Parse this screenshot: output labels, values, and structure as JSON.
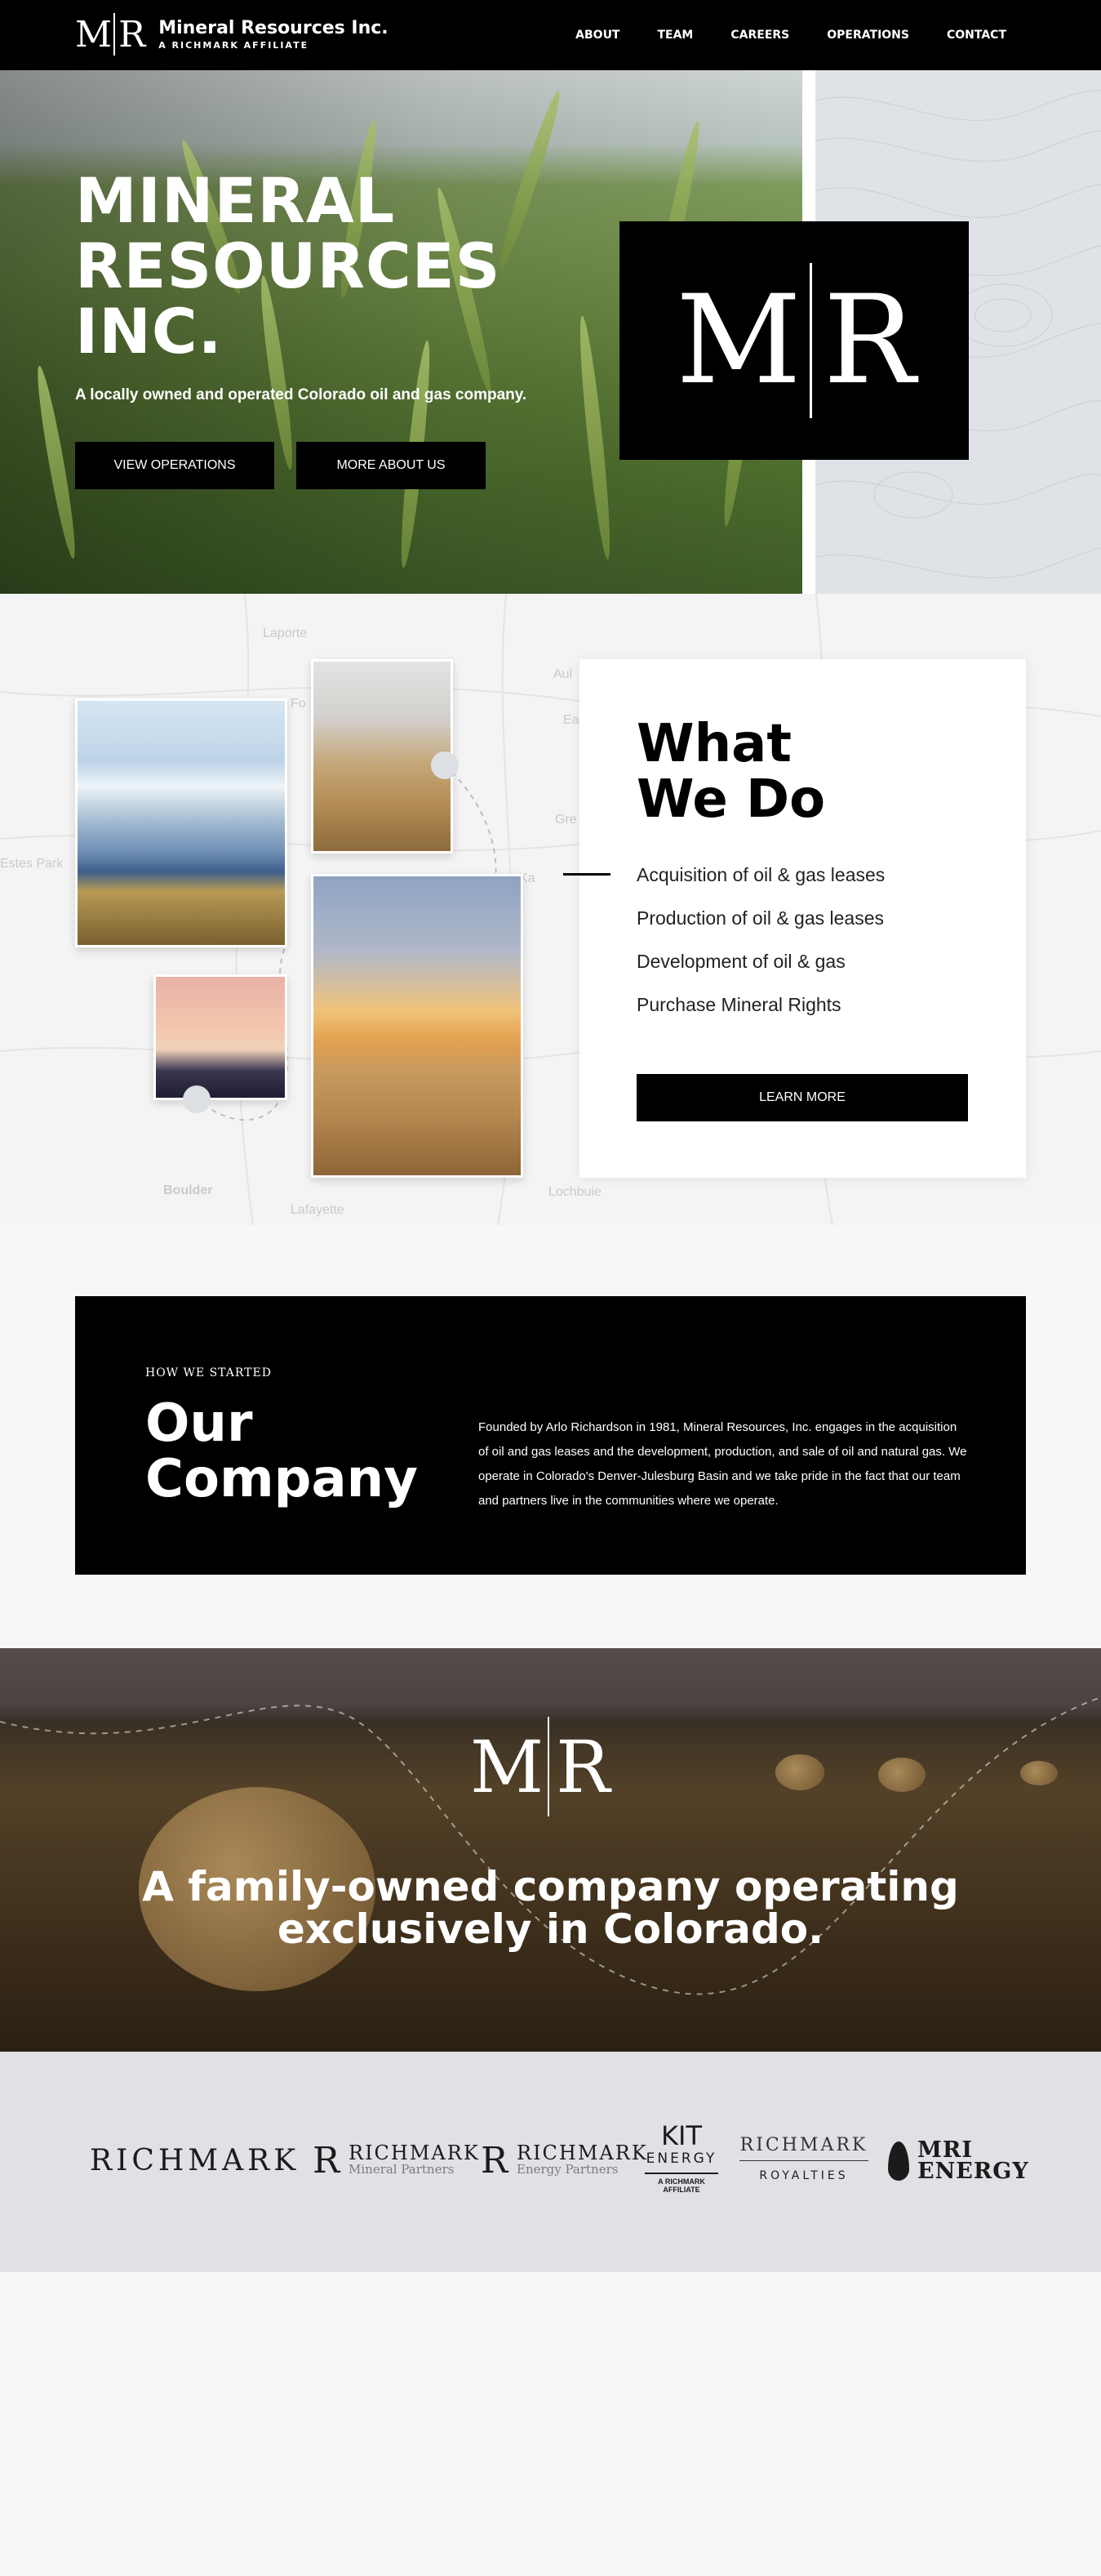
{
  "nav": {
    "brand_mark_left": "M",
    "brand_mark_right": "R",
    "brand_title": "Mineral Resources Inc.",
    "brand_subtitle": "A RICHMARK AFFILIATE",
    "items": [
      {
        "label": "ABOUT"
      },
      {
        "label": "TEAM"
      },
      {
        "label": "CAREERS"
      },
      {
        "label": "OPERATIONS"
      },
      {
        "label": "CONTACT"
      }
    ]
  },
  "hero": {
    "title_line1": "MINERAL",
    "title_line2": "RESOURCES",
    "title_line3": "INC.",
    "tagline": "A locally owned and operated Colorado oil and gas company.",
    "button_operations": "VIEW OPERATIONS",
    "button_about": "MORE ABOUT US",
    "logo_left": "M",
    "logo_right": "R"
  },
  "what_we_do": {
    "title_line1": "What",
    "title_line2": "We Do",
    "items": [
      "Acquisition of oil & gas leases",
      "Production of oil & gas leases",
      "Development of oil & gas",
      "Purchase Mineral Rights"
    ],
    "button_label": "LEARN MORE",
    "map_labels": [
      "Laporte",
      "Fo",
      "Aul",
      "Ea",
      "Gre",
      "Ka",
      "Estes Park",
      "Boulder",
      "Lafayette",
      "Lochbuie"
    ]
  },
  "company": {
    "eyebrow": "HOW WE STARTED",
    "title_line1": "Our",
    "title_line2": "Company",
    "body": "Founded by Arlo Richardson in 1981, Mineral Resources, Inc. engages in the acquisition of oil and gas leases and the development, production, and sale of oil and natural gas. We operate in Colorado's Denver-Julesburg Basin and we take pride in the fact that our team and partners live in the communities where we operate."
  },
  "family": {
    "logo_left": "M",
    "logo_right": "R",
    "text_line1": "A family-owned company operating",
    "text_line2": "exclusively in Colorado."
  },
  "partners": {
    "richmark": "RICHMARK",
    "richmark_mineral": {
      "main": "RICHMARK",
      "sub": "Mineral Partners"
    },
    "richmark_energy": {
      "main": "RICHMARK",
      "sub": "Energy Partners"
    },
    "kit_energy": {
      "main": "KIT",
      "sub": "ENERGY",
      "note": "A RICHMARK AFFILIATE"
    },
    "richmark_royalties": {
      "main": "RICHMARK",
      "sub": "ROYALTIES"
    },
    "mri_energy": {
      "main": "MRI",
      "sub": "ENERGY"
    }
  }
}
